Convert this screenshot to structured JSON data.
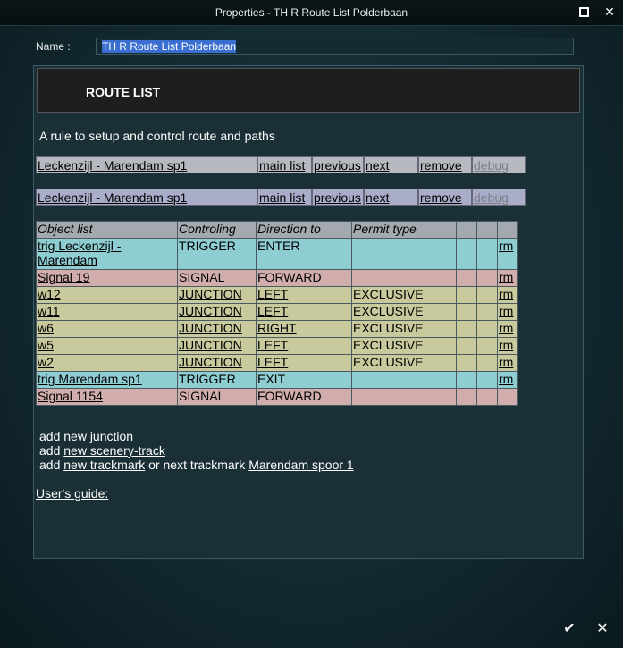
{
  "window": {
    "title": "Properties - TH R Route List Polderbaan"
  },
  "name_field": {
    "label": "Name :",
    "value": "TH R Route List Polderbaan"
  },
  "header": {
    "title": "ROUTE LIST"
  },
  "description": "A rule to setup and control route and paths",
  "nav_rows": [
    {
      "route": "Leckenzijl - Marendam sp1",
      "main_list": "main list",
      "previous": "previous",
      "next": "next",
      "remove": "remove",
      "debug": "debug"
    },
    {
      "route": "Leckenzijl - Marendam sp1",
      "main_list": "main list",
      "previous": "previous",
      "next": "next",
      "remove": "remove",
      "debug": "debug"
    }
  ],
  "table": {
    "headers": [
      "Object list",
      "Controling",
      "Direction to",
      "Permit type"
    ],
    "rows": [
      {
        "object": "trig Leckenzijl - Marendam",
        "control": "TRIGGER",
        "direction": "ENTER",
        "permit": "",
        "rm": "rm",
        "kind": "trig"
      },
      {
        "object": "Signal 19",
        "control": "SIGNAL",
        "direction": "FORWARD",
        "permit": "",
        "rm": "rm",
        "kind": "sig"
      },
      {
        "object": "w12",
        "control": "JUNCTION",
        "direction": "LEFT",
        "permit": "EXCLUSIVE",
        "rm": "rm",
        "kind": "junc"
      },
      {
        "object": "w11",
        "control": "JUNCTION",
        "direction": "LEFT",
        "permit": "EXCLUSIVE",
        "rm": "rm",
        "kind": "junc"
      },
      {
        "object": "w6",
        "control": "JUNCTION",
        "direction": "RIGHT",
        "permit": "EXCLUSIVE",
        "rm": "rm",
        "kind": "junc"
      },
      {
        "object": "w5",
        "control": "JUNCTION",
        "direction": "LEFT",
        "permit": "EXCLUSIVE",
        "rm": "rm",
        "kind": "junc"
      },
      {
        "object": "w2",
        "control": "JUNCTION",
        "direction": "LEFT",
        "permit": "EXCLUSIVE",
        "rm": "rm",
        "kind": "junc"
      },
      {
        "object": "trig Marendam sp1",
        "control": "TRIGGER",
        "direction": "EXIT",
        "permit": "",
        "rm": "rm",
        "kind": "trig"
      },
      {
        "object": "Signal 1154",
        "control": "SIGNAL",
        "direction": "FORWARD",
        "permit": "",
        "rm": "",
        "kind": "sig"
      }
    ]
  },
  "adds": {
    "add_word": "add",
    "new_junction": "new junction",
    "new_scenery_track": "new scenery-track",
    "new_trackmark": "new trackmark",
    "or_next": "or next trackmark",
    "trackmark_name": "Marendam spoor 1"
  },
  "users_guide": "User's guide:",
  "icons": {
    "ok": "check-icon",
    "cancel": "close-icon",
    "maximize": "maximize-icon"
  }
}
